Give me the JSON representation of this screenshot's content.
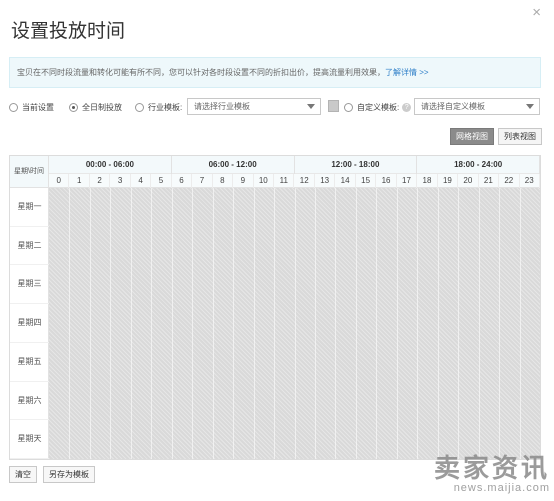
{
  "dialog": {
    "title": "设置投放时间",
    "close_glyph": "×"
  },
  "tip": {
    "text": "宝贝在不同时段流量和转化可能有所不同，您可以针对各时段设置不同的折扣出价，提高流量利用效果，",
    "link": "了解详情 >>"
  },
  "options": {
    "current": "当前设置",
    "all_day": "全日制投放",
    "industry": "行业模板:",
    "industry_placeholder": "请选择行业模板",
    "custom": "自定义模板:",
    "custom_placeholder": "请选择自定义模板",
    "help_glyph": "?",
    "selected": "all_day"
  },
  "views": {
    "grid": "网格视图",
    "list": "列表视图",
    "active": "grid"
  },
  "grid": {
    "corner": "星期\\时间",
    "ranges": [
      "00:00 - 06:00",
      "06:00 - 12:00",
      "12:00 - 18:00",
      "18:00 - 24:00"
    ],
    "hours": [
      "0",
      "1",
      "2",
      "3",
      "4",
      "5",
      "6",
      "7",
      "8",
      "9",
      "10",
      "11",
      "12",
      "13",
      "14",
      "15",
      "16",
      "17",
      "18",
      "19",
      "20",
      "21",
      "22",
      "23"
    ],
    "days": [
      "星期一",
      "星期二",
      "星期三",
      "星期四",
      "星期五",
      "星期六",
      "星期天"
    ],
    "all_selected": true
  },
  "footer": {
    "clear": "清空",
    "save_template": "另存为模板"
  },
  "watermark": {
    "main": "卖家资讯",
    "sub": "news.maijia.com"
  },
  "colors": {
    "selected_cell": "#d9d9d9",
    "header_bg": "#f3f9fb",
    "tip_bg": "#eef8fb",
    "link": "#2f7fc8"
  }
}
